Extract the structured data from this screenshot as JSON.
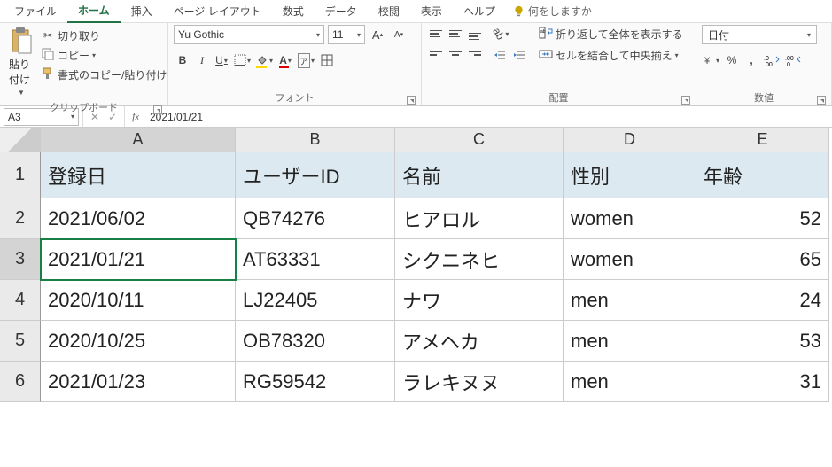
{
  "menu": {
    "items": [
      "ファイル",
      "ホーム",
      "挿入",
      "ページ レイアウト",
      "数式",
      "データ",
      "校閲",
      "表示",
      "ヘルプ"
    ],
    "tellme": "何をしますか"
  },
  "ribbon": {
    "clipboard": {
      "paste": "貼り付け",
      "cut": "切り取り",
      "copy": "コピー",
      "formatpainter": "書式のコピー/貼り付け",
      "label": "クリップボード"
    },
    "font": {
      "name": "Yu Gothic",
      "size": "11",
      "label": "フォント",
      "ruby": "ア"
    },
    "align": {
      "wrap": "折り返して全体を表示する",
      "merge": "セルを結合して中央揃え",
      "label": "配置"
    },
    "number": {
      "format": "日付",
      "label": "数値"
    }
  },
  "formula": {
    "cellref": "A3",
    "value": "2021/01/21"
  },
  "grid": {
    "cols": [
      "A",
      "B",
      "C",
      "D",
      "E"
    ],
    "headers": [
      "登録日",
      "ユーザーID",
      "名前",
      "性別",
      "年齢"
    ],
    "rows": [
      {
        "n": "2",
        "c": [
          "2021/06/02",
          "QB74276",
          "ヒアロル",
          "women",
          "52"
        ]
      },
      {
        "n": "3",
        "c": [
          "2021/01/21",
          "AT63331",
          "シクニネヒ",
          "women",
          "65"
        ]
      },
      {
        "n": "4",
        "c": [
          "2020/10/11",
          "LJ22405",
          "ナワ",
          "men",
          "24"
        ]
      },
      {
        "n": "5",
        "c": [
          "2020/10/25",
          "OB78320",
          "アメヘカ",
          "men",
          "53"
        ]
      },
      {
        "n": "6",
        "c": [
          "2021/01/23",
          "RG59542",
          "ラレキヌヌ",
          "men",
          "31"
        ]
      }
    ]
  },
  "chart_data": {
    "type": "table",
    "title": "",
    "columns": [
      "登録日",
      "ユーザーID",
      "名前",
      "性別",
      "年齢"
    ],
    "rows": [
      [
        "2021/06/02",
        "QB74276",
        "ヒアロル",
        "women",
        52
      ],
      [
        "2021/01/21",
        "AT63331",
        "シクニネヒ",
        "women",
        65
      ],
      [
        "2020/10/11",
        "LJ22405",
        "ナワ",
        "men",
        24
      ],
      [
        "2020/10/25",
        "OB78320",
        "アメヘカ",
        "men",
        53
      ],
      [
        "2021/01/23",
        "RG59542",
        "ラレキヌヌ",
        "men",
        31
      ]
    ]
  }
}
